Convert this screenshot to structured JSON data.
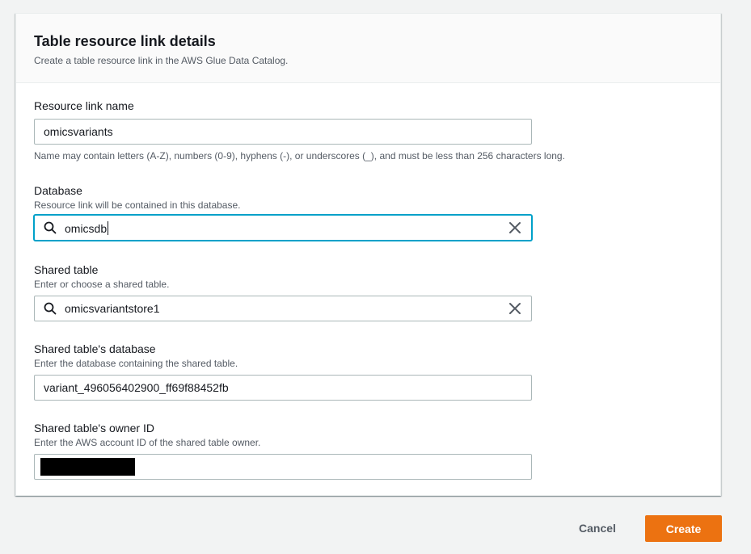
{
  "panel": {
    "title": "Table resource link details",
    "description": "Create a table resource link in the AWS Glue Data Catalog."
  },
  "fields": {
    "resource_link_name": {
      "label": "Resource link name",
      "value": "omicsvariants",
      "constraint": "Name may contain letters (A-Z), numbers (0-9), hyphens (-), or underscores (_), and must be less than 256 characters long."
    },
    "database": {
      "label": "Database",
      "hint": "Resource link will be contained in this database.",
      "value": "omicsdb"
    },
    "shared_table": {
      "label": "Shared table",
      "hint": "Enter or choose a shared table.",
      "value": "omicsvariantstore1"
    },
    "shared_table_database": {
      "label": "Shared table's database",
      "hint": "Enter the database containing the shared table.",
      "value": "variant_496056402900_ff69f88452fb"
    },
    "shared_table_owner_id": {
      "label": "Shared table's owner ID",
      "hint": "Enter the AWS account ID of the shared table owner.",
      "value": ""
    }
  },
  "actions": {
    "cancel_label": "Cancel",
    "create_label": "Create"
  },
  "colors": {
    "primary_button": "#ec7211",
    "focus_border": "#00a1c9"
  },
  "icons": {
    "search": "search-icon",
    "clear": "close-icon"
  }
}
